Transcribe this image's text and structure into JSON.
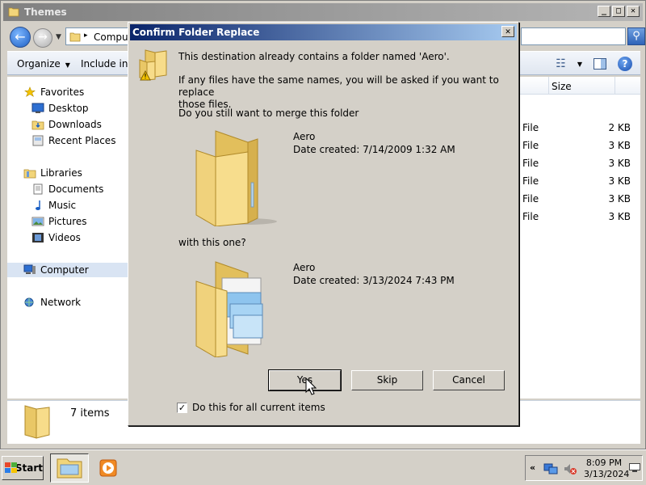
{
  "explorer": {
    "title": "Themes",
    "address_text": "Computer",
    "toolbar": {
      "organize": "Organize",
      "include": "Include in lib"
    },
    "column_size": "Size",
    "files": [
      {
        "type": "File",
        "size": "2 KB"
      },
      {
        "type": "File",
        "size": "3 KB"
      },
      {
        "type": "File",
        "size": "3 KB"
      },
      {
        "type": "File",
        "size": "3 KB"
      },
      {
        "type": "File",
        "size": "3 KB"
      },
      {
        "type": "File",
        "size": "3 KB"
      }
    ],
    "nav": {
      "favorites": "Favorites",
      "desktop": "Desktop",
      "downloads": "Downloads",
      "recent": "Recent Places",
      "libraries": "Libraries",
      "documents": "Documents",
      "music": "Music",
      "pictures": "Pictures",
      "videos": "Videos",
      "computer": "Computer",
      "network": "Network"
    },
    "details_count": "7 items"
  },
  "dialog": {
    "title": "Confirm Folder Replace",
    "close_glyph": "✕",
    "line1": "This destination already contains a folder named 'Aero'.",
    "line2a": "If any files have the same names, you will be asked if you want to replace",
    "line2b": "those files.",
    "line3": "Do you still want to merge this folder",
    "existing": {
      "name": "Aero",
      "date": "Date created: 7/14/2009 1:32 AM"
    },
    "with_text": "with this one?",
    "incoming": {
      "name": "Aero",
      "date": "Date created: 3/13/2024 7:43 PM"
    },
    "buttons": {
      "yes": "Yes",
      "skip": "Skip",
      "cancel": "Cancel"
    },
    "checkbox": {
      "label": "Do this for all current items",
      "checked": true,
      "glyph": "✓"
    }
  },
  "taskbar": {
    "start": "Start",
    "time": "8:09 PM",
    "date": "3/13/2024",
    "tray_chevron": "«"
  },
  "window_buttons": {
    "minimize": "_",
    "maximize": "□",
    "close": "✕"
  },
  "icons": {
    "back": "←",
    "forward": "→",
    "dropdown": "▼",
    "search": "⚲",
    "help": "?",
    "views": "☷"
  },
  "colors": {
    "dialog_title_start": "#0a246a",
    "dialog_title_end": "#a6caf0",
    "face": "#d4d0c8",
    "folder": "#f2d57a"
  }
}
